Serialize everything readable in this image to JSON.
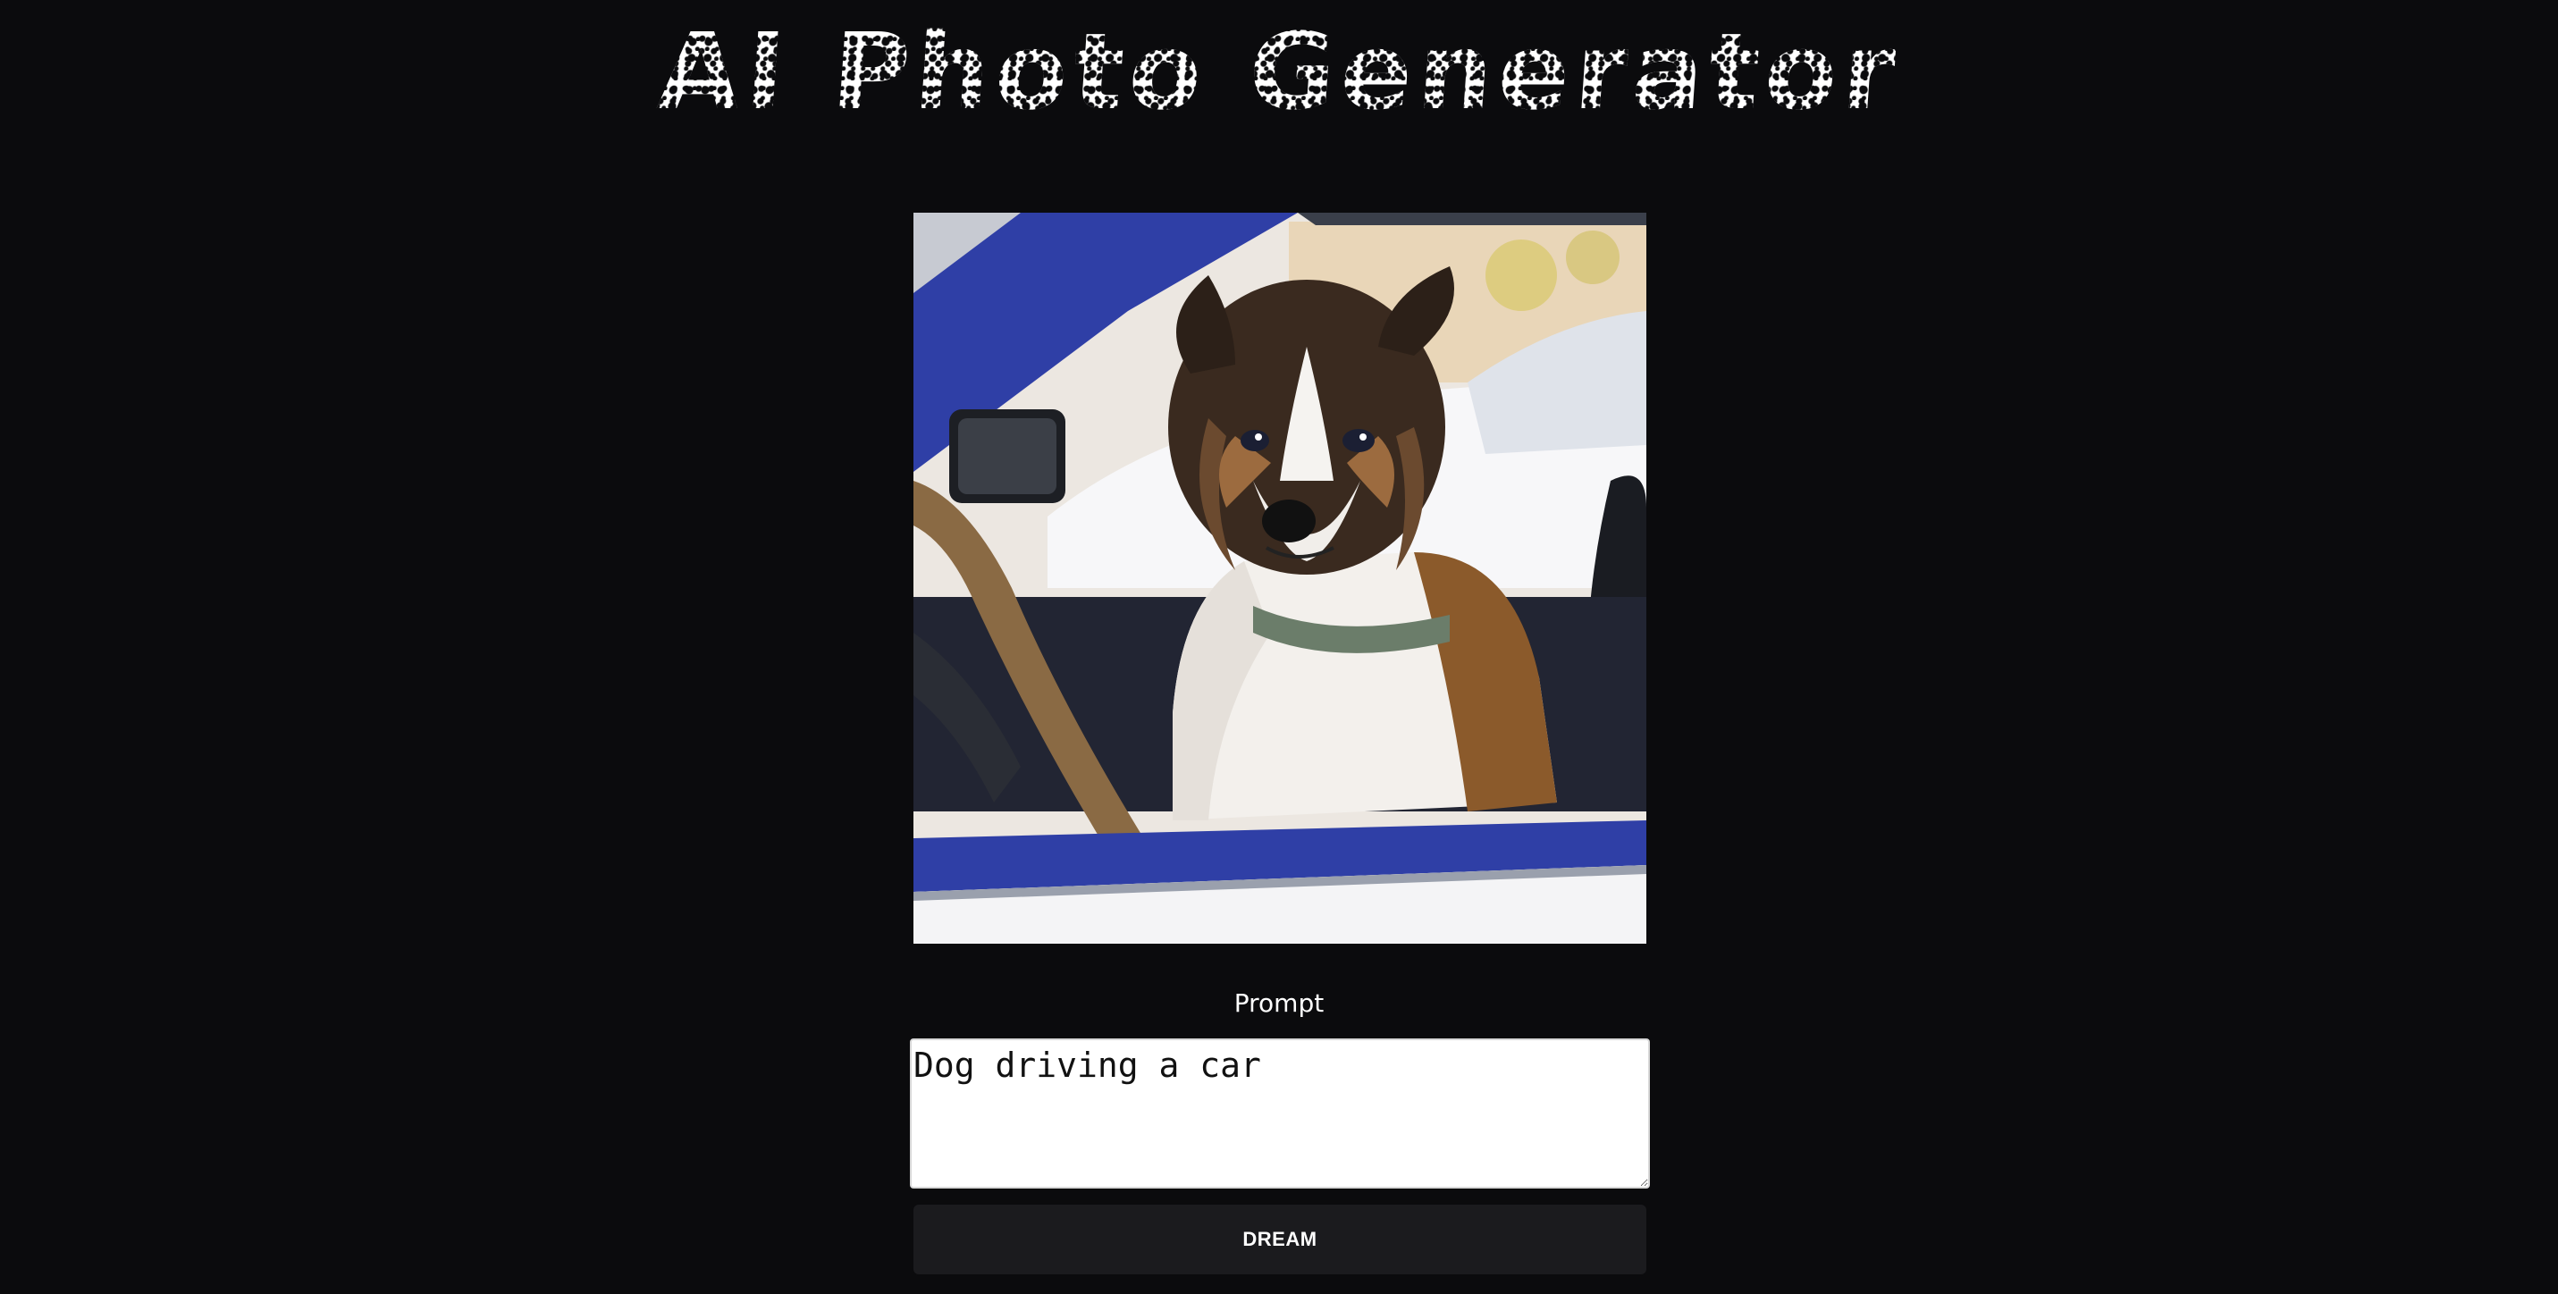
{
  "header": {
    "title": "AI Photo Generator"
  },
  "image": {
    "description_icon": "generated-dog-driving-car-image"
  },
  "form": {
    "prompt_label": "Prompt",
    "prompt_value": "Dog driving a car",
    "submit_label": "DREAM"
  },
  "colors": {
    "background": "#0b0b0d",
    "button_bg": "#1b1b1e",
    "car_blue": "#2f3fa6",
    "text": "#ffffff"
  }
}
